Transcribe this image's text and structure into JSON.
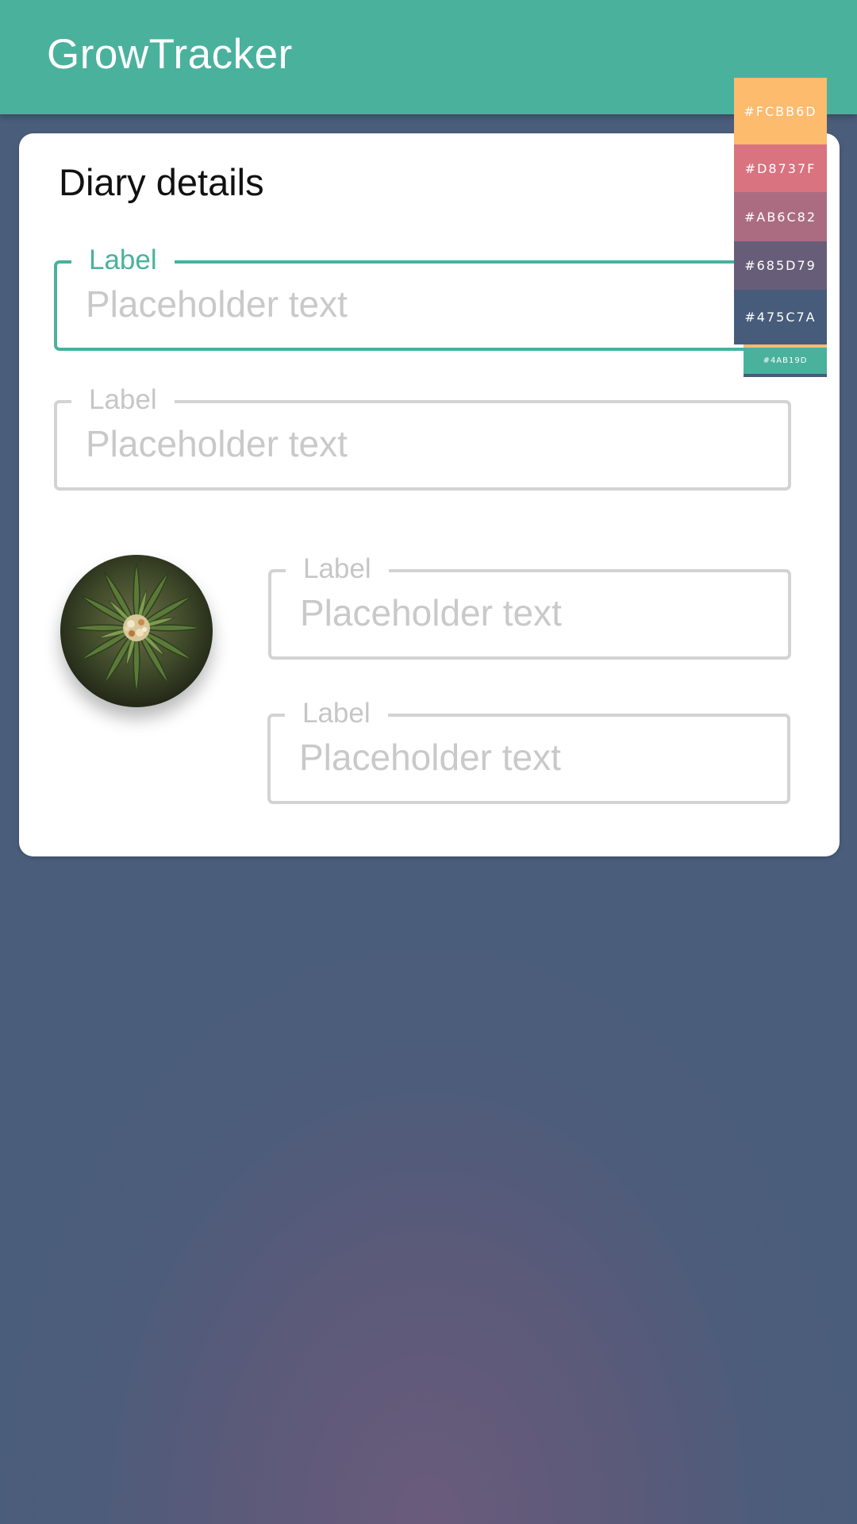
{
  "app_bar": {
    "title": "GrowTracker",
    "color": "#4AB19D"
  },
  "card": {
    "title": "Diary details",
    "fields": [
      {
        "label": "Label",
        "placeholder": "Placeholder text",
        "value": "",
        "focused": true
      },
      {
        "label": "Label",
        "placeholder": "Placeholder text",
        "value": "",
        "focused": false
      },
      {
        "label": "Label",
        "placeholder": "Placeholder text",
        "value": "",
        "focused": false
      },
      {
        "label": "Label",
        "placeholder": "Placeholder text",
        "value": "",
        "focused": false
      }
    ],
    "avatar_icon": "plant-photo"
  },
  "palette": {
    "swatches": [
      {
        "hex": "#FCBB6D",
        "label": "#FCBB6D"
      },
      {
        "hex": "#D8737F",
        "label": "#D8737F"
      },
      {
        "hex": "#AB6C82",
        "label": "#AB6C82"
      },
      {
        "hex": "#685D79",
        "label": "#685D79"
      },
      {
        "hex": "#475C7A",
        "label": "#475C7A"
      }
    ],
    "accent": {
      "hex": "#4AB19D",
      "label": "#4AB19D"
    }
  }
}
